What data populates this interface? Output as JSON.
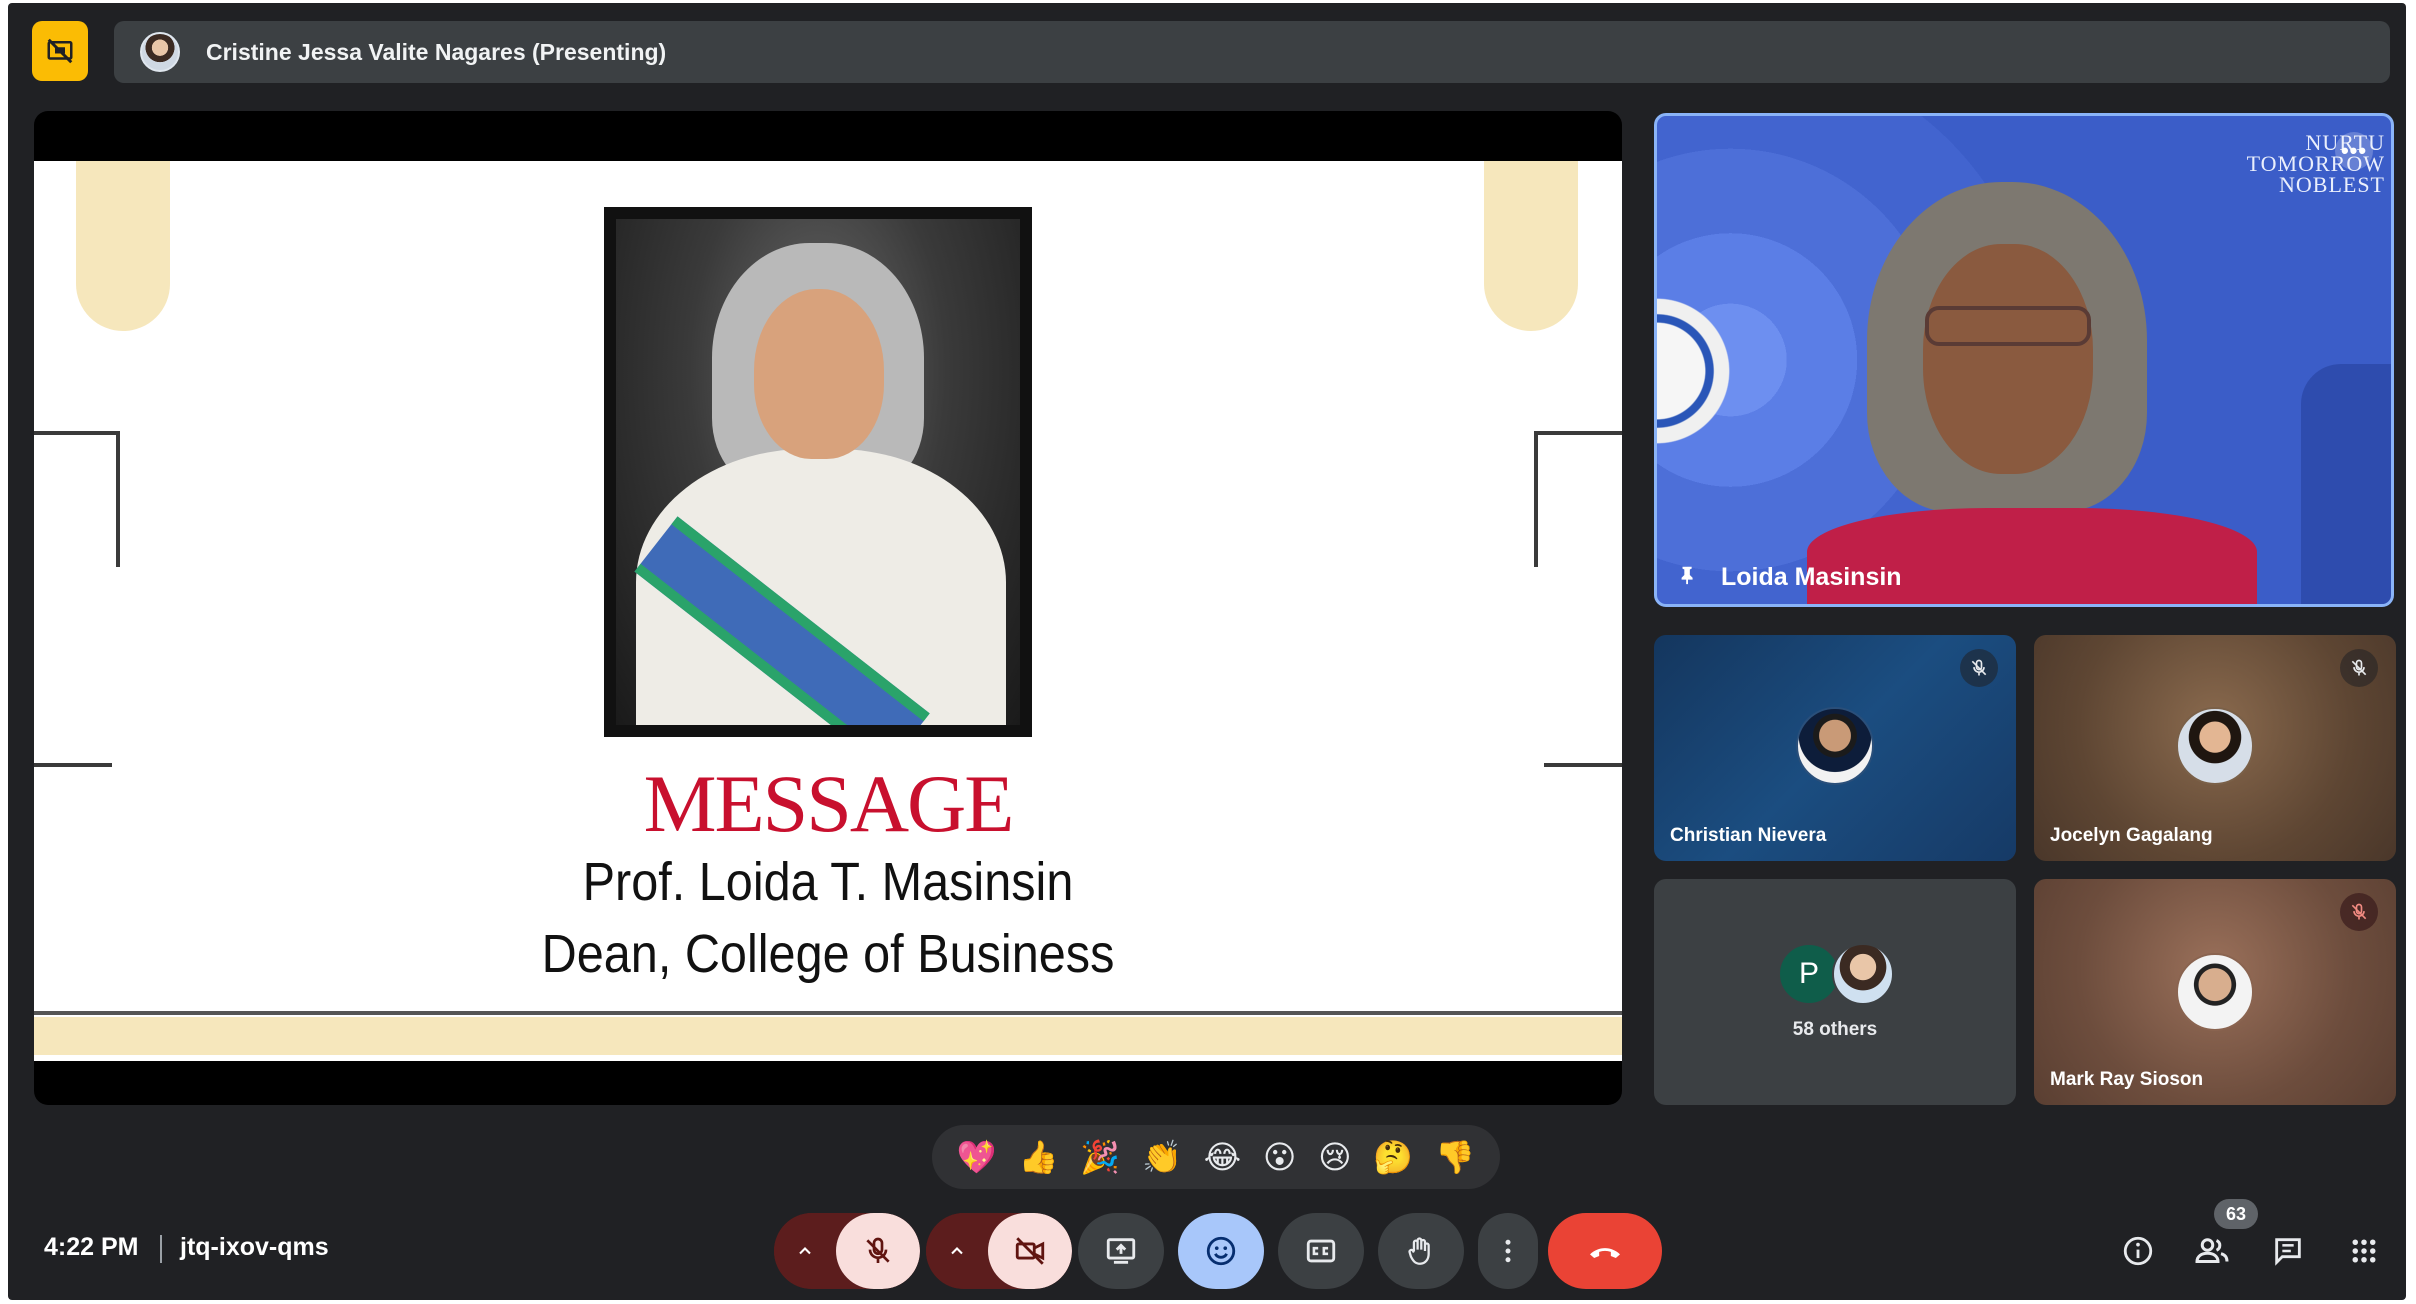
{
  "topbar": {
    "presenter_label": "Cristine Jessa Valite Nagares (Presenting)",
    "stop_presenting_icon": "present-off-icon"
  },
  "slide": {
    "title": "MESSAGE",
    "line1": "Prof. Loida T. Masinsin",
    "line2": "Dean, College of Business"
  },
  "featured_tile": {
    "name": "Loida Masinsin",
    "brand_line1": "NURTU",
    "brand_line2": "TOMORROW",
    "brand_line3": "NOBLEST",
    "icon": "pin-icon"
  },
  "participants": [
    {
      "name": "Christian Nievera",
      "muted": true
    },
    {
      "name": "Jocelyn Gagalang",
      "muted": true
    },
    {
      "name": "Mark Ray Sioson",
      "muted": true
    }
  ],
  "others_tile": {
    "initial": "P",
    "label": "58 others"
  },
  "reactions": [
    "💖",
    "👍",
    "🎉",
    "👏",
    "😂",
    "😮",
    "😢",
    "🤔",
    "👎"
  ],
  "bottombar": {
    "time": "4:22 PM",
    "meeting_code": "jtq-ixov-qms",
    "people_count": "63"
  },
  "colors": {
    "app_bg": "#202124",
    "accent_yellow": "#fbbc04",
    "leave_red": "#ea4335",
    "active_blue": "#a8c7fa",
    "slide_title_red": "#c8102e"
  }
}
